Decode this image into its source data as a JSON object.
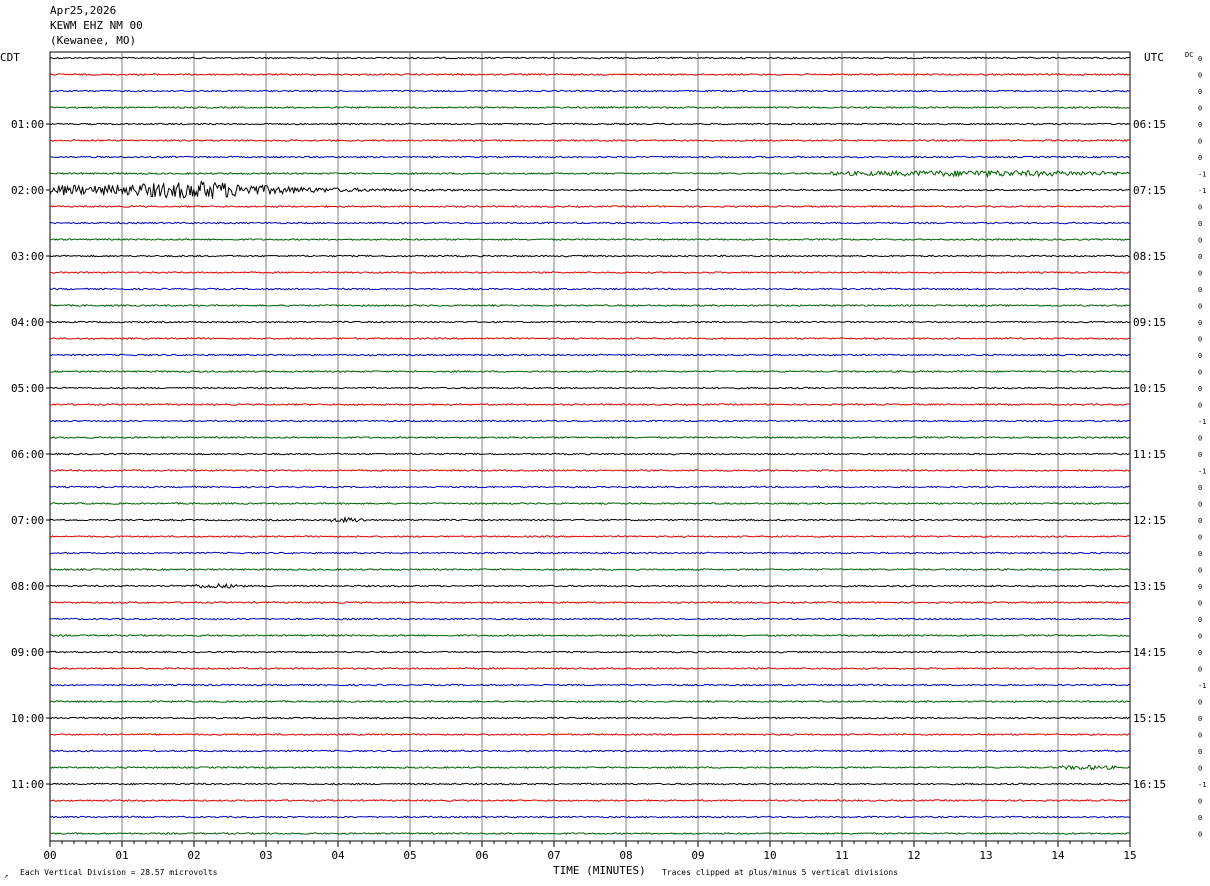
{
  "header": {
    "date": "Apr25,2026",
    "station": "KEWM EHZ NM 00",
    "location": "(Kewanee, MO)"
  },
  "left_axis_title": "CDT",
  "right_axis_title": "UTC",
  "dc_label": "DC",
  "footer": {
    "corner_mark": "↗",
    "scale_note": "Each Vertical Division =   28.57 microvolts",
    "clip_note": "Traces clipped at plus/minus 5 vertical divisions"
  },
  "colors": {
    "traces": [
      "#000000",
      "#e00000",
      "#0000c0",
      "#006000"
    ],
    "grid": "#808080",
    "frame": "#000000"
  },
  "chart_data": {
    "type": "line",
    "xlabel": "TIME (MINUTES)",
    "xlim": [
      0,
      15
    ],
    "x_ticks": [
      "00",
      "01",
      "02",
      "03",
      "04",
      "05",
      "06",
      "07",
      "08",
      "09",
      "10",
      "11",
      "12",
      "13",
      "14",
      "15"
    ],
    "row_count": 48,
    "left_hour_labels": [
      "01:00",
      "02:00",
      "03:00",
      "04:00",
      "05:00",
      "06:00",
      "07:00",
      "08:00",
      "09:00",
      "10:00",
      "11:00"
    ],
    "right_hour_labels": [
      "06:15",
      "07:15",
      "08:15",
      "09:15",
      "10:15",
      "11:15",
      "12:15",
      "13:15",
      "14:15",
      "15:15",
      "16:15"
    ],
    "labeled_row_start": 4,
    "labeled_row_step": 4,
    "dc_offsets": [
      "0",
      "0",
      "0",
      "0",
      "0",
      "0",
      "0",
      "-1",
      "-1",
      "0",
      "0",
      "0",
      "0",
      "0",
      "0",
      "0",
      "0",
      "0",
      "0",
      "0",
      "0",
      "0",
      "-1",
      "0",
      "0",
      "-1",
      "0",
      "0",
      "0",
      "0",
      "0",
      "0",
      "0",
      "0",
      "0",
      "0",
      "0",
      "0",
      "-1",
      "0",
      "0",
      "0",
      "0",
      "0",
      "-1",
      "0",
      "0",
      "0"
    ],
    "events": [
      {
        "row": 8,
        "start_min": 0.0,
        "peak_min": 2.2,
        "end_min": 6.0,
        "amplitude": 9
      },
      {
        "row": 7,
        "start_min": 10.8,
        "end_min": 15.0,
        "amplitude": 2.6
      },
      {
        "row": 28,
        "start_min": 3.9,
        "end_min": 4.4,
        "amplitude": 2
      },
      {
        "row": 32,
        "start_min": 1.9,
        "end_min": 2.7,
        "amplitude": 1.8
      },
      {
        "row": 43,
        "start_min": 14.0,
        "end_min": 14.8,
        "amplitude": 1.8
      }
    ]
  }
}
